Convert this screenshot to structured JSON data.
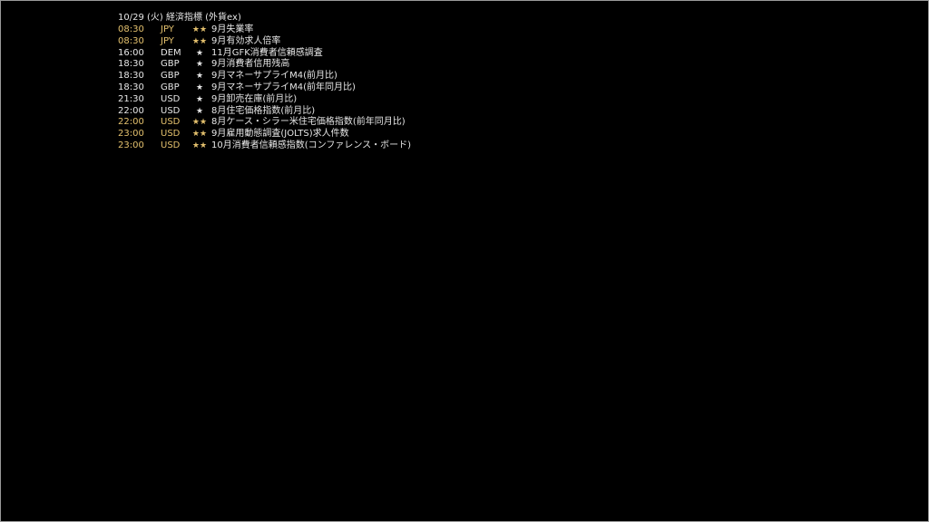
{
  "header": {
    "title": "10/29 (火) 経済指標 (外貨ex)"
  },
  "colors": {
    "background": "#000000",
    "text": "#e6e6e6",
    "highlight": "#e3c06d",
    "border": "#9a9a9a"
  },
  "events": [
    {
      "time": "08:30",
      "currency": "JPY",
      "stars": "★★",
      "name": "9月失業率",
      "importance": "high"
    },
    {
      "time": "08:30",
      "currency": "JPY",
      "stars": "★★",
      "name": "9月有効求人倍率",
      "importance": "high"
    },
    {
      "time": "16:00",
      "currency": "DEM",
      "stars": "★",
      "name": "11月GFK消費者信頼感調査",
      "importance": "low"
    },
    {
      "time": "18:30",
      "currency": "GBP",
      "stars": "★",
      "name": "9月消費者信用残高",
      "importance": "low"
    },
    {
      "time": "18:30",
      "currency": "GBP",
      "stars": "★",
      "name": "9月マネーサプライM4(前月比)",
      "importance": "low"
    },
    {
      "time": "18:30",
      "currency": "GBP",
      "stars": "★",
      "name": "9月マネーサプライM4(前年同月比)",
      "importance": "low"
    },
    {
      "time": "21:30",
      "currency": "USD",
      "stars": "★",
      "name": "9月卸売在庫(前月比)",
      "importance": "low"
    },
    {
      "time": "22:00",
      "currency": "USD",
      "stars": "★",
      "name": "8月住宅価格指数(前月比)",
      "importance": "low"
    },
    {
      "time": "22:00",
      "currency": "USD",
      "stars": "★★",
      "name": "8月ケース・シラー米住宅価格指数(前年同月比)",
      "importance": "high"
    },
    {
      "time": "23:00",
      "currency": "USD",
      "stars": "★★",
      "name": "9月雇用動態調査(JOLTS)求人件数",
      "importance": "high"
    },
    {
      "time": "23:00",
      "currency": "USD",
      "stars": "★★",
      "name": "10月消費者信頼感指数(コンファレンス・ボード)",
      "importance": "high"
    }
  ]
}
